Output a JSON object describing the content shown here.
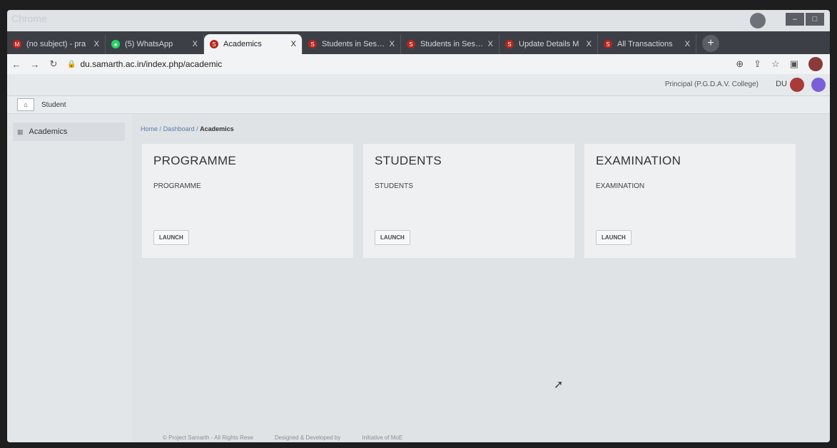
{
  "browser": {
    "top_label": "Chrome",
    "tabs": [
      {
        "label": "(no subject) - pra",
        "color": "#c5221f"
      },
      {
        "label": "(5) WhatsApp",
        "color": "#25d366"
      },
      {
        "label": "Academics",
        "color": "#b3261e",
        "active": true
      },
      {
        "label": "Students in Sessio",
        "color": "#b3261e"
      },
      {
        "label": "Students in Sessio",
        "color": "#b3261e"
      },
      {
        "label": "Update Details M",
        "color": "#b3261e"
      },
      {
        "label": "All Transactions",
        "color": "#b3261e"
      }
    ],
    "tab_close": "X",
    "new_tab": "+",
    "url": "du.samarth.ac.in/index.php/academic"
  },
  "header": {
    "user_role": "Principal (P.G.D.A.V. College)",
    "org": "DU"
  },
  "context_bar": {
    "label": "Student"
  },
  "sidebar": {
    "items": [
      {
        "label": "Academics"
      }
    ]
  },
  "breadcrumb": {
    "home": "Home",
    "sep": "/",
    "dashboard": "Dashboard",
    "current": "Academics"
  },
  "cards": [
    {
      "title": "PROGRAMME",
      "subtitle": "PROGRAMME",
      "button": "LAUNCH"
    },
    {
      "title": "STUDENTS",
      "subtitle": "STUDENTS",
      "button": "LAUNCH"
    },
    {
      "title": "EXAMINATION",
      "subtitle": "EXAMINATION",
      "button": "LAUNCH"
    }
  ],
  "footer": {
    "copyright": "© Project Samarth - All Rights Rese",
    "designed": "Designed & Developed by",
    "initiative": "Initiative of MoE"
  }
}
